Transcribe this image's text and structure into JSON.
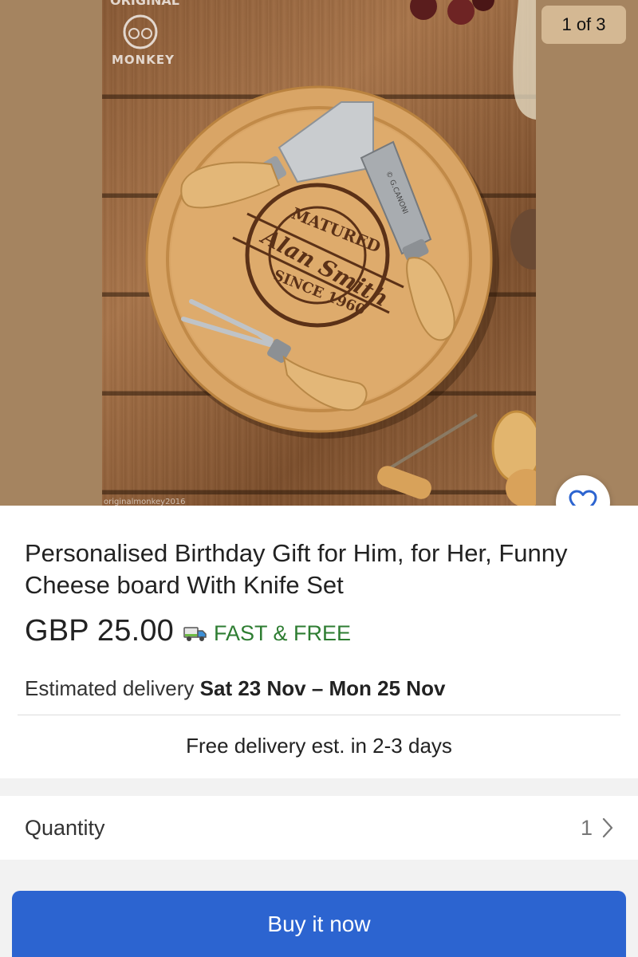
{
  "gallery": {
    "counter": "1 of 3",
    "watermark_logo_top": "ORIGINAL",
    "watermark_logo_bottom": "MONKEY",
    "watermark_caption": "originalmonkey2016",
    "board_engraving": {
      "top_arc": "MATURED",
      "name": "Alan Smith",
      "bottom_arc": "SINCE 1960"
    },
    "knife_stamp": "© G.CANONI",
    "favorite_icon": "heart-outline-icon",
    "background_color": "#a58460"
  },
  "product": {
    "title": "Personalised Birthday Gift for Him, for Her, Funny Cheese board With Knife Set",
    "price": "GBP 25.00",
    "shipping_icon": "delivery-truck-icon",
    "shipping_badge": "FAST & FREE",
    "shipping_color": "#2e7d32",
    "delivery_prefix": "Estimated delivery",
    "delivery_dates": "Sat 23 Nov – Mon 25 Nov",
    "free_delivery_note": "Free delivery est. in 2-3 days"
  },
  "quantity": {
    "label": "Quantity",
    "value": "1",
    "chevron_icon": "chevron-right-icon"
  },
  "actions": {
    "buy_now_label": "Buy it now",
    "buy_now_color": "#2c64d0"
  }
}
